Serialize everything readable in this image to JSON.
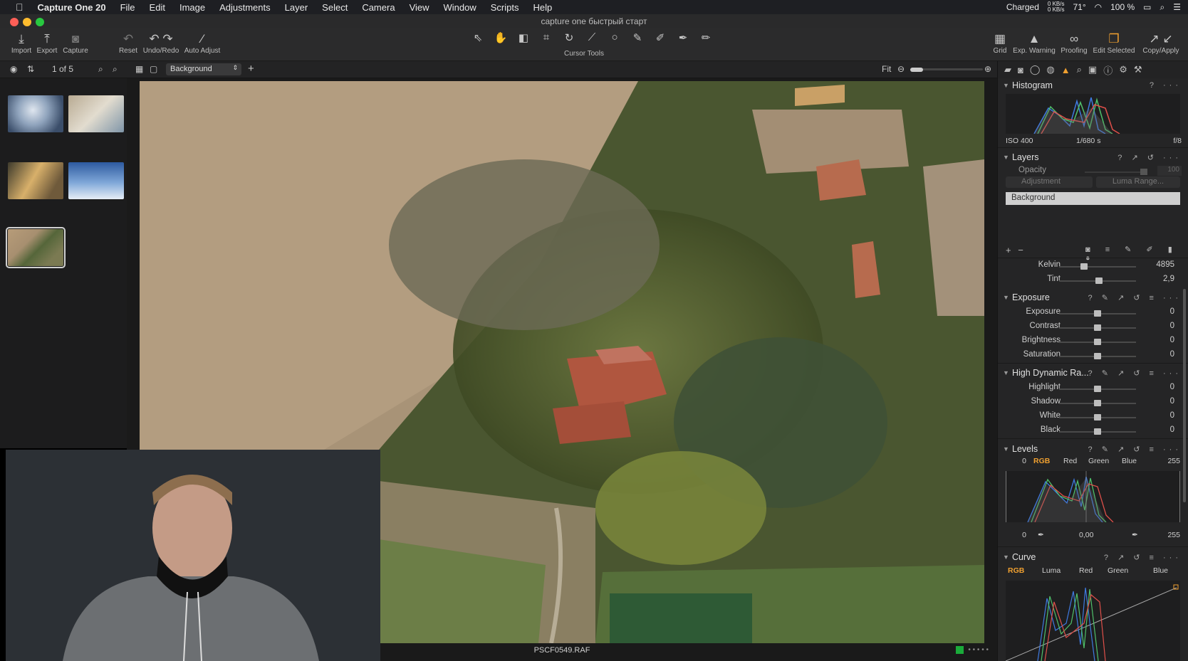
{
  "menubar": {
    "apple": "",
    "app": "Capture One 20",
    "items": [
      "File",
      "Edit",
      "Image",
      "Adjustments",
      "Layer",
      "Select",
      "Camera",
      "View",
      "Window",
      "Scripts",
      "Help"
    ],
    "status": {
      "battery_text": "Charged",
      "net_up": "0 KB/s",
      "net_down": "0 KB/s",
      "temp": "71°",
      "battery_pct": "100 %"
    }
  },
  "window": {
    "title": "capture one быстрый старт"
  },
  "toolbar": {
    "left": [
      {
        "label": "Import",
        "icon": "import-icon"
      },
      {
        "label": "Export",
        "icon": "export-icon"
      },
      {
        "label": "Capture",
        "icon": "camera-icon"
      },
      {
        "label": "Reset",
        "icon": "reset-icon"
      },
      {
        "label": "Undo/Redo",
        "icon": "undo-icon"
      },
      {
        "label": "Auto Adjust",
        "icon": "magic-wand-icon"
      }
    ],
    "cursor_tools_label": "Cursor Tools",
    "right": [
      {
        "label": "Grid",
        "icon": "grid-icon"
      },
      {
        "label": "Exp. Warning",
        "icon": "warning-icon"
      },
      {
        "label": "Proofing",
        "icon": "glasses-icon"
      },
      {
        "label": "Edit Selected",
        "icon": "edit-selected-icon"
      },
      {
        "label": "Copy/Apply",
        "icon": "copy-apply-icon"
      }
    ]
  },
  "subbar": {
    "count": "1 of 5",
    "variant_select": "Background",
    "zoom": "Fit"
  },
  "viewer": {
    "filename": "PSCF0549.RAF"
  },
  "histogram": {
    "title": "Histogram",
    "iso": "ISO 400",
    "shutter": "1/680 s",
    "aperture": "f/8"
  },
  "layers": {
    "title": "Layers",
    "opacity_label": "Opacity",
    "opacity_value": "100",
    "adjustment": "Adjustment",
    "luma_range": "Luma Range...",
    "items": [
      "Background"
    ]
  },
  "white_balance": {
    "rows": [
      {
        "label": "Kelvin",
        "value": "4895",
        "pos": 0.32
      },
      {
        "label": "Tint",
        "value": "2,9",
        "pos": 0.52
      }
    ]
  },
  "exposure": {
    "title": "Exposure",
    "rows": [
      {
        "label": "Exposure",
        "value": "0",
        "pos": 0.5
      },
      {
        "label": "Contrast",
        "value": "0",
        "pos": 0.5
      },
      {
        "label": "Brightness",
        "value": "0",
        "pos": 0.5
      },
      {
        "label": "Saturation",
        "value": "0",
        "pos": 0.5
      }
    ]
  },
  "hdr": {
    "title": "High Dynamic Ra...",
    "rows": [
      {
        "label": "Highlight",
        "value": "0",
        "pos": 0.5
      },
      {
        "label": "Shadow",
        "value": "0",
        "pos": 0.5
      },
      {
        "label": "White",
        "value": "0",
        "pos": 0.5
      },
      {
        "label": "Black",
        "value": "0",
        "pos": 0.5
      }
    ]
  },
  "levels": {
    "title": "Levels",
    "low": "0",
    "high": "255",
    "channels": [
      "RGB",
      "Red",
      "Green",
      "Blue"
    ],
    "active_channel": "RGB",
    "out_low": "0",
    "mid": "0,00",
    "out_high": "255"
  },
  "curve": {
    "title": "Curve",
    "channels": [
      "RGB",
      "Luma",
      "Red",
      "Green",
      "Blue"
    ],
    "active_channel": "RGB"
  },
  "colors": {
    "accent": "#f0a030",
    "panel": "#252526"
  }
}
